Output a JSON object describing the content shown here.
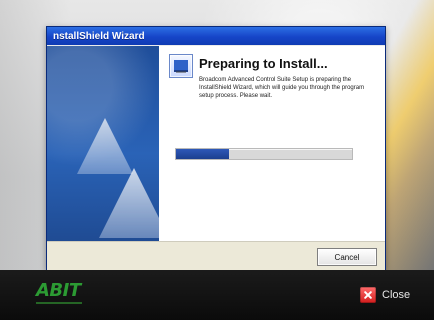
{
  "window": {
    "title": "nstallShield Wizard"
  },
  "wizard": {
    "heading": "Preparing to Install...",
    "description": "Broadcom Advanced Control Suite Setup is preparing the InstallShield Wizard, which will guide you through the program setup process. Please wait.",
    "progress_percent": 30,
    "cancel_label": "Cancel"
  },
  "launcher": {
    "brand": "ABIT",
    "close_label": "Close"
  },
  "icons": {
    "setup": "setup-icon",
    "sails": "sails-illustration",
    "close": "close-icon"
  },
  "colors": {
    "titlebar_blue": "#1645c8",
    "progress_blue": "#2e58b8",
    "brand_green": "#2c9b33",
    "close_red": "#d21d1d"
  }
}
